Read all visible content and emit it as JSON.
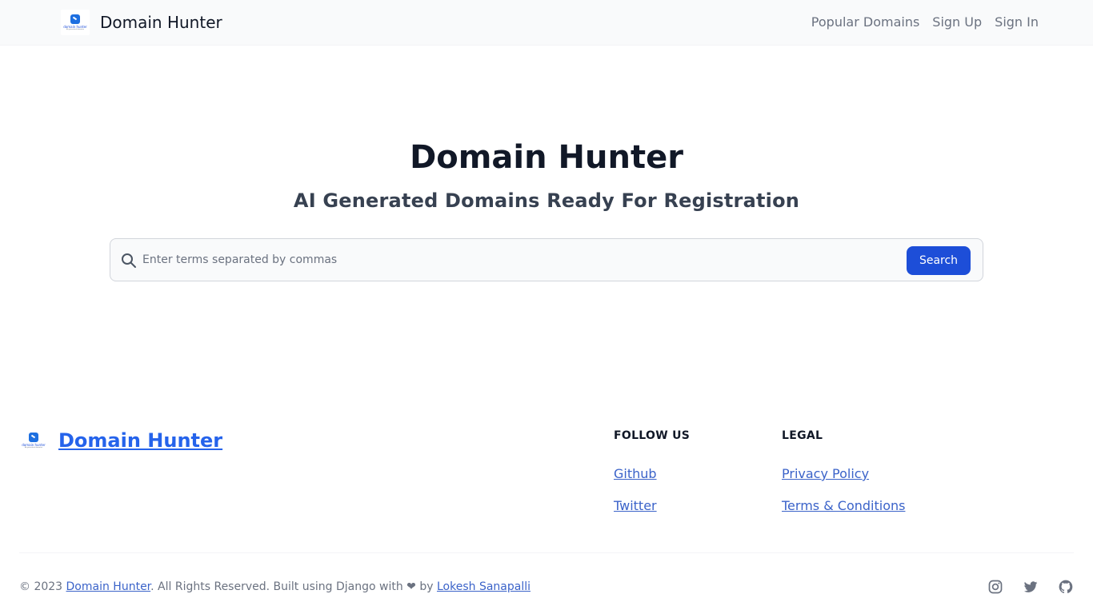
{
  "navbar": {
    "brand": "Domain Hunter",
    "logo_text": "domain hunter",
    "logo_subtext": "AI generated domains",
    "links": [
      "Popular Domains",
      "Sign Up",
      "Sign In"
    ]
  },
  "hero": {
    "title": "Domain Hunter",
    "subtitle": "AI Generated Domains Ready For Registration"
  },
  "search": {
    "placeholder": "Enter terms separated by commas",
    "value": "",
    "button_label": "Search",
    "icon": "search-icon"
  },
  "footer": {
    "brand": "Domain Hunter",
    "follow_heading": "FOLLOW US",
    "follow_links": [
      "Github",
      "Twitter"
    ],
    "legal_heading": "LEGAL",
    "legal_links": [
      "Privacy Policy",
      "Terms & Conditions"
    ],
    "copyright_prefix": "© 2023 ",
    "copyright_brand": "Domain Hunter",
    "copyright_middle": ". All Rights Reserved. Built using Django with ❤ by ",
    "copyright_author": "Lokesh Sanapalli",
    "social_icons": [
      "instagram-icon",
      "twitter-icon",
      "github-icon"
    ]
  },
  "colors": {
    "primary_button": "#1d4ed8",
    "link": "#3b63c9",
    "navbar_bg": "#f9fafb"
  }
}
